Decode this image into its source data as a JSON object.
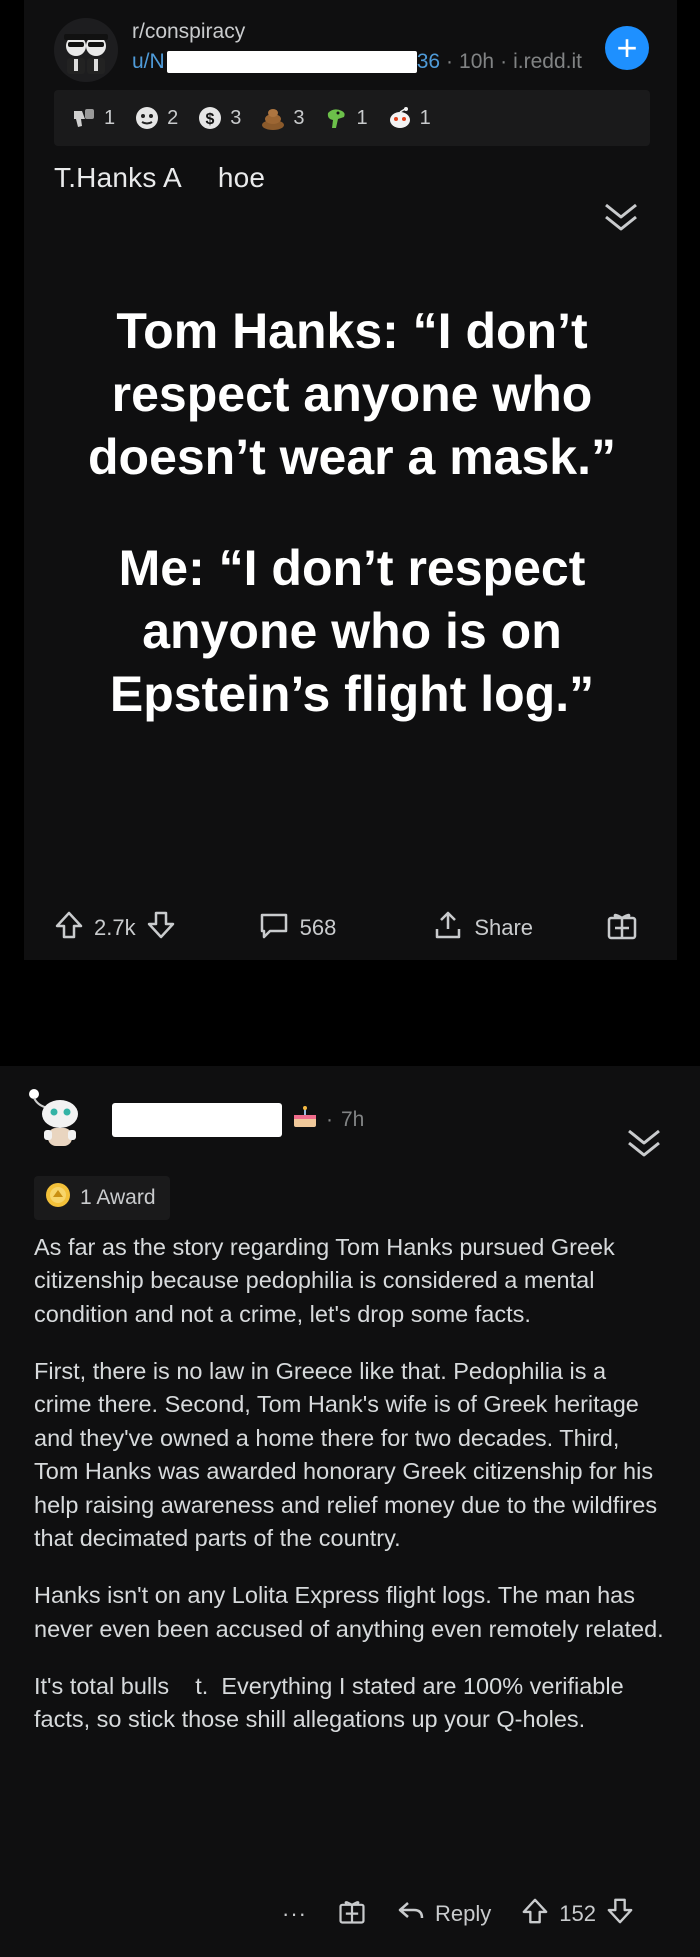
{
  "post": {
    "subreddit": "r/conspiracy",
    "user_prefix": "u/N",
    "user_suffix": "36",
    "time": "10h",
    "domain": "i.redd.it",
    "join_symbol": "+",
    "awards": [
      {
        "icon": "thumbs-down-award-icon",
        "count": "1"
      },
      {
        "icon": "face-award-icon",
        "count": "2"
      },
      {
        "icon": "dollar-award-icon",
        "count": "3"
      },
      {
        "icon": "poop-award-icon",
        "count": "3"
      },
      {
        "icon": "dino-award-icon",
        "count": "1"
      },
      {
        "icon": "snoo-award-icon",
        "count": "1"
      }
    ],
    "title_part1": "T.Hanks A",
    "title_part2": "hoe",
    "image_text": {
      "paragraph1": "Tom Hanks: “I don’t respect anyone who doesn’t wear a mask.”",
      "paragraph2": "Me: “I don’t respect anyone who is on Epstein’s flight log.”"
    },
    "score": "2.7k",
    "comments": "568",
    "share_label": "Share"
  },
  "comment": {
    "flair_icon": "cake-icon",
    "time": "7h",
    "award_label": "1 Award",
    "paragraphs": [
      "As far as the story regarding Tom Hanks pursued Greek citizenship because pedophilia is considered a mental condition and not a crime, let's drop some facts.",
      "First, there is no law in Greece like that. Pedophilia is a crime there.  Second, Tom Hank's wife is of Greek heritage and they've owned a home there for two decades.  Third, Tom Hanks was awarded honorary Greek citizenship for his help raising awareness and relief money due to the wildfires that decimated parts of the country.",
      "Hanks isn't on any Lolita Express flight logs.  The man has never even been accused of anything even remotely related.",
      "It's total bulls    t.  Everything I stated are 100% verifiable facts, so stick those shill allegations up your Q-holes."
    ],
    "more_label": "···",
    "reply_label": "Reply",
    "score": "152"
  },
  "colors": {
    "background": "#000000",
    "card": "#0f0f10",
    "link_blue": "#4f9bd9",
    "join_blue": "#1e90ff"
  }
}
